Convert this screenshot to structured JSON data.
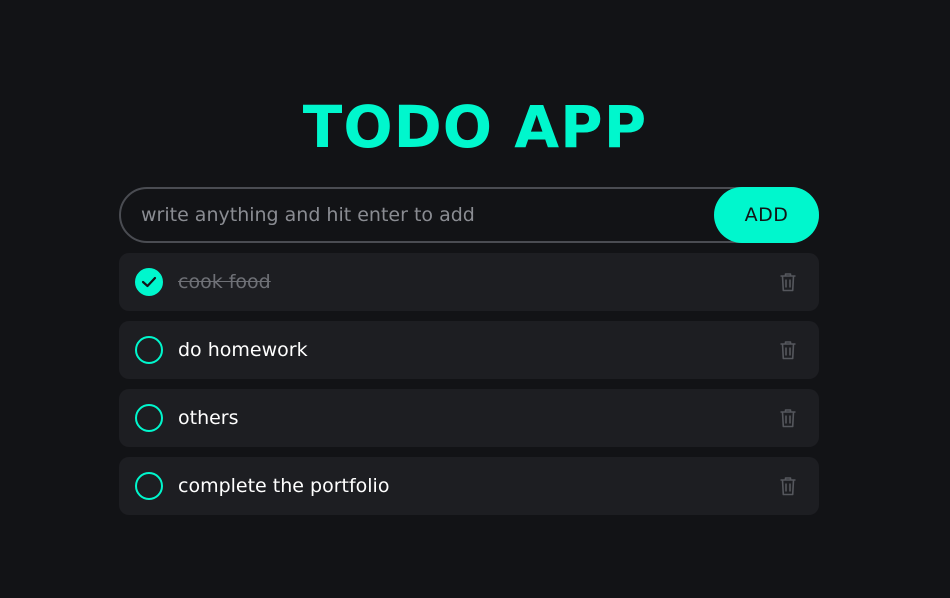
{
  "header": {
    "title": "TODO APP"
  },
  "input": {
    "placeholder": "write anything and hit enter to add",
    "value": ""
  },
  "add_button": {
    "label": "ADD"
  },
  "todos": [
    {
      "text": "cook food",
      "completed": true
    },
    {
      "text": "do homework",
      "completed": false
    },
    {
      "text": "others",
      "completed": false
    },
    {
      "text": "complete the portfolio",
      "completed": false
    }
  ],
  "icons": {
    "check": "check-icon",
    "delete": "trash-icon"
  },
  "colors": {
    "background": "#121316",
    "accent": "#00f7cd",
    "item_background": "#1d1e22",
    "muted": "#6e7076"
  }
}
